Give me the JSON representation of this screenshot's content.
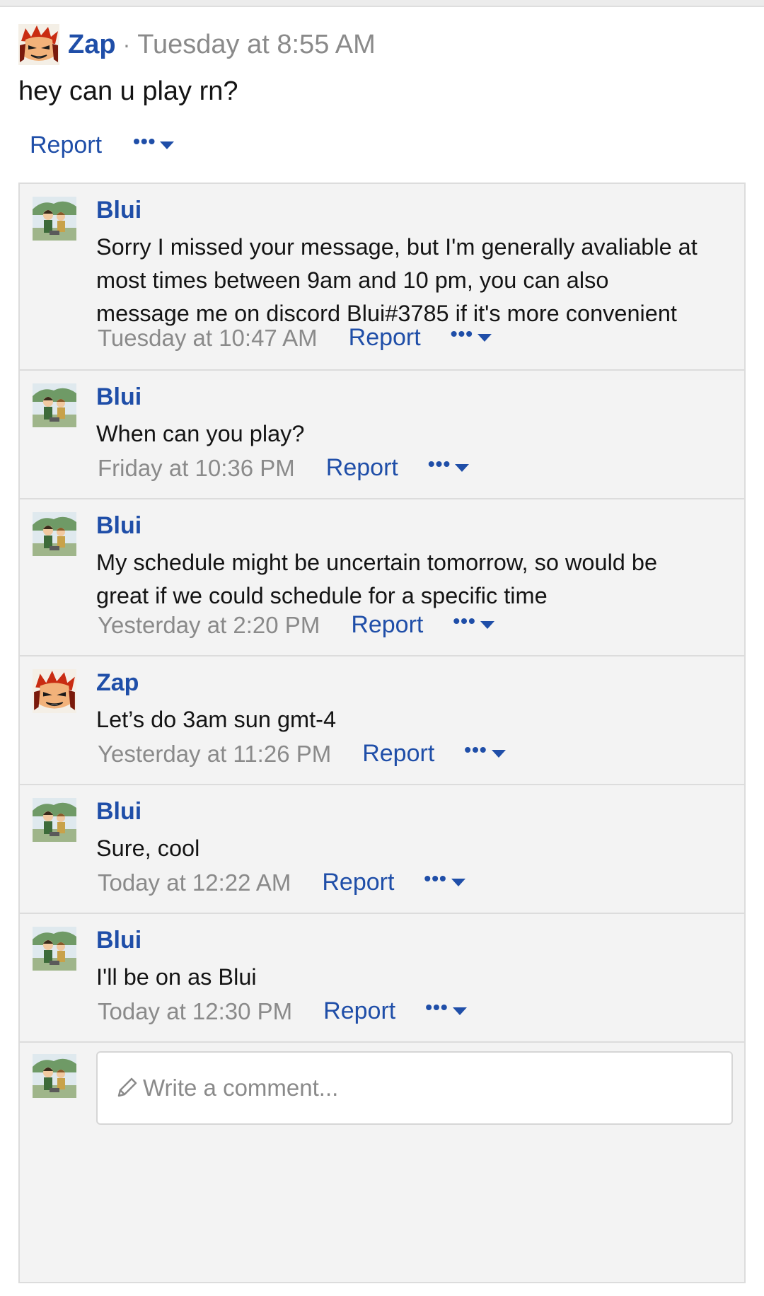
{
  "post": {
    "author": "Zap",
    "separator": "·",
    "timestamp": "Tuesday at 8:55 AM",
    "body": "hey can u play rn?",
    "report_label": "Report",
    "more_label": "•••"
  },
  "comments": [
    {
      "author": "Blui",
      "avatar": "blui-avatar",
      "lines": [
        "Sorry I missed your message, but I'm generally avaliable at",
        "most times between 9am and 10 pm, you can also",
        "message me on discord Blui#3785 if it's more convenient"
      ],
      "timestamp": "Tuesday at 10:47 AM",
      "report_label": "Report",
      "more_label": "•••"
    },
    {
      "author": "Blui",
      "avatar": "blui-avatar",
      "lines": [
        "When can you play?"
      ],
      "timestamp": "Friday at 10:36 PM",
      "report_label": "Report",
      "more_label": "•••"
    },
    {
      "author": "Blui",
      "avatar": "blui-avatar",
      "lines": [
        "My schedule might be uncertain tomorrow, so would be",
        "great if we could schedule for a specific time"
      ],
      "timestamp": "Yesterday at 2:20 PM",
      "report_label": "Report",
      "more_label": "•••"
    },
    {
      "author": "Zap",
      "avatar": "zap-avatar",
      "lines": [
        "Let’s do 3am sun gmt-4"
      ],
      "timestamp": "Yesterday at 11:26 PM",
      "report_label": "Report",
      "more_label": "•••"
    },
    {
      "author": "Blui",
      "avatar": "blui-avatar",
      "lines": [
        "Sure, cool"
      ],
      "timestamp": "Today at 12:22 AM",
      "report_label": "Report",
      "more_label": "•••"
    },
    {
      "author": "Blui",
      "avatar": "blui-avatar",
      "lines": [
        "I'll be on as Blui"
      ],
      "timestamp": "Today at 12:30 PM",
      "report_label": "Report",
      "more_label": "•••"
    }
  ],
  "composer": {
    "placeholder": "Write a comment..."
  },
  "colors": {
    "link": "#1f4ea8",
    "muted": "#8a8a8a",
    "comment_bg": "#f3f3f3",
    "border": "#dcdcdc"
  },
  "icons": {
    "more": "ellipsis-icon",
    "dropdown": "caret-down-icon",
    "composer": "pencil-icon"
  }
}
